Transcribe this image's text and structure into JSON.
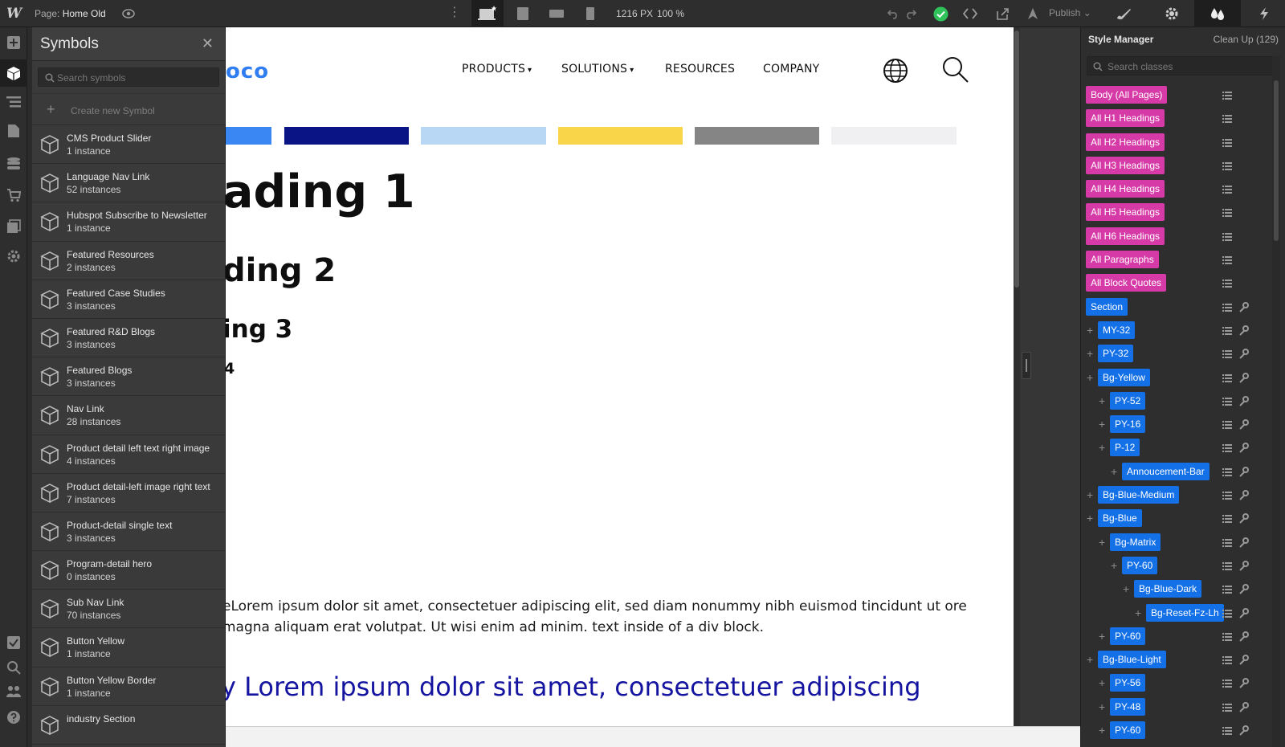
{
  "topbar": {
    "app_logo": "W",
    "page_label": "Page:",
    "page_name": "Home Old",
    "canvas_width": "1216 PX",
    "zoom": "100 %",
    "publish_label": "Publish",
    "icons": [
      "eye-icon",
      "more-icon",
      "desktop-icon",
      "tablet-icon",
      "mobile-landscape-icon",
      "mobile-portrait-icon",
      "undo-icon",
      "redo-icon",
      "check-icon",
      "code-icon",
      "export-icon",
      "publish-icon",
      "style-brush-icon",
      "settings-icon",
      "style-manager-icon",
      "interactions-icon"
    ],
    "status_color": "#2fc25b"
  },
  "left_rail": {
    "icons": [
      "add-icon",
      "symbols-icon",
      "navigator-icon",
      "pages-icon",
      "cms-icon",
      "ecommerce-icon",
      "assets-icon",
      "settings-icon",
      "audit-icon",
      "search-icon",
      "team-icon",
      "help-icon"
    ]
  },
  "symbols": {
    "title": "Symbols",
    "search_placeholder": "Search symbols",
    "create_label": "Create new Symbol",
    "items": [
      {
        "name": "CMS Product Slider",
        "count": "1 instance"
      },
      {
        "name": "Language Nav Link",
        "count": "52 instances"
      },
      {
        "name": "Hubspot Subscribe to Newsletter",
        "count": "1 instance"
      },
      {
        "name": "Featured Resources",
        "count": "2 instances"
      },
      {
        "name": "Featured Case Studies",
        "count": "3 instances"
      },
      {
        "name": "Featured R&D Blogs",
        "count": "3 instances"
      },
      {
        "name": "Featured Blogs",
        "count": "3 instances"
      },
      {
        "name": "Nav Link",
        "count": "28 instances"
      },
      {
        "name": "Product detail left text right image",
        "count": "4 instances"
      },
      {
        "name": "Product detail-left image right text",
        "count": "7 instances"
      },
      {
        "name": "Product-detail single text",
        "count": "3 instances"
      },
      {
        "name": "Program-detail hero",
        "count": "0 instances"
      },
      {
        "name": "Sub Nav Link",
        "count": "70 instances"
      },
      {
        "name": "Button Yellow",
        "count": "1 instance"
      },
      {
        "name": "Button Yellow Border",
        "count": "1 instance"
      },
      {
        "name": "industry Section",
        "count": ""
      }
    ]
  },
  "canvas": {
    "brand_fragment": "oco",
    "nav": [
      "PRODUCTS",
      "SOLUTIONS",
      "RESOURCES",
      "COMPANY"
    ],
    "swatches": [
      "#3a86f3",
      "#0b1485",
      "#b7d7f5",
      "#f9d54a",
      "#858585",
      "#f0f0f3"
    ],
    "heading1": "ading 1",
    "heading2": "ding 2",
    "heading3": "ing 3",
    "heading4": "4",
    "paragraph": "eLorem ipsum dolor sit amet, consectetuer adipiscing elit, sed diam nonummy nibh euismod tincidunt ut ore magna aliquam erat volutpat. Ut wisi enim ad minim. text inside of a div block.",
    "quote": "y Lorem ipsum dolor sit amet, consectetuer adipiscing"
  },
  "style_manager": {
    "title": "Style Manager",
    "cleanup": "Clean Up (129)",
    "search_placeholder": "Search classes",
    "classes": [
      {
        "label": "Body (All Pages)",
        "color": "pink",
        "depth": 0,
        "plus": false,
        "wrench": false
      },
      {
        "label": "All H1 Headings",
        "color": "pink",
        "depth": 0,
        "plus": false,
        "wrench": false
      },
      {
        "label": "All H2 Headings",
        "color": "pink",
        "depth": 0,
        "plus": false,
        "wrench": false
      },
      {
        "label": "All H3 Headings",
        "color": "pink",
        "depth": 0,
        "plus": false,
        "wrench": false
      },
      {
        "label": "All H4 Headings",
        "color": "pink",
        "depth": 0,
        "plus": false,
        "wrench": false
      },
      {
        "label": "All H5 Headings",
        "color": "pink",
        "depth": 0,
        "plus": false,
        "wrench": false
      },
      {
        "label": "All H6 Headings",
        "color": "pink",
        "depth": 0,
        "plus": false,
        "wrench": false
      },
      {
        "label": "All Paragraphs",
        "color": "pink",
        "depth": 0,
        "plus": false,
        "wrench": false
      },
      {
        "label": "All Block Quotes",
        "color": "pink",
        "depth": 0,
        "plus": false,
        "wrench": false
      },
      {
        "label": "Section",
        "color": "blue",
        "depth": 0,
        "plus": false,
        "wrench": true
      },
      {
        "label": "MY-32",
        "color": "blue",
        "depth": 1,
        "plus": true,
        "wrench": true
      },
      {
        "label": "PY-32",
        "color": "blue",
        "depth": 1,
        "plus": true,
        "wrench": true
      },
      {
        "label": "Bg-Yellow",
        "color": "blue",
        "depth": 1,
        "plus": true,
        "wrench": true
      },
      {
        "label": "PY-52",
        "color": "blue",
        "depth": 2,
        "plus": true,
        "wrench": true
      },
      {
        "label": "PY-16",
        "color": "blue",
        "depth": 2,
        "plus": true,
        "wrench": true
      },
      {
        "label": "P-12",
        "color": "blue",
        "depth": 2,
        "plus": true,
        "wrench": true
      },
      {
        "label": "Annoucement-Bar",
        "color": "blue",
        "depth": 3,
        "plus": true,
        "wrench": true
      },
      {
        "label": "Bg-Blue-Medium",
        "color": "blue",
        "depth": 1,
        "plus": true,
        "wrench": true
      },
      {
        "label": "Bg-Blue",
        "color": "blue",
        "depth": 1,
        "plus": true,
        "wrench": true
      },
      {
        "label": "Bg-Matrix",
        "color": "blue",
        "depth": 2,
        "plus": true,
        "wrench": true
      },
      {
        "label": "PY-60",
        "color": "blue",
        "depth": 3,
        "plus": true,
        "wrench": true
      },
      {
        "label": "Bg-Blue-Dark",
        "color": "blue",
        "depth": 4,
        "plus": true,
        "wrench": true
      },
      {
        "label": "Bg-Reset-Fz-Lh",
        "color": "blue",
        "depth": 5,
        "plus": true,
        "wrench": true
      },
      {
        "label": "PY-60",
        "color": "blue",
        "depth": 2,
        "plus": true,
        "wrench": true
      },
      {
        "label": "Bg-Blue-Light",
        "color": "blue",
        "depth": 1,
        "plus": true,
        "wrench": true
      },
      {
        "label": "PY-56",
        "color": "blue",
        "depth": 2,
        "plus": true,
        "wrench": true
      },
      {
        "label": "PY-48",
        "color": "blue",
        "depth": 2,
        "plus": true,
        "wrench": true
      },
      {
        "label": "PY-60",
        "color": "blue",
        "depth": 2,
        "plus": true,
        "wrench": true
      }
    ]
  }
}
